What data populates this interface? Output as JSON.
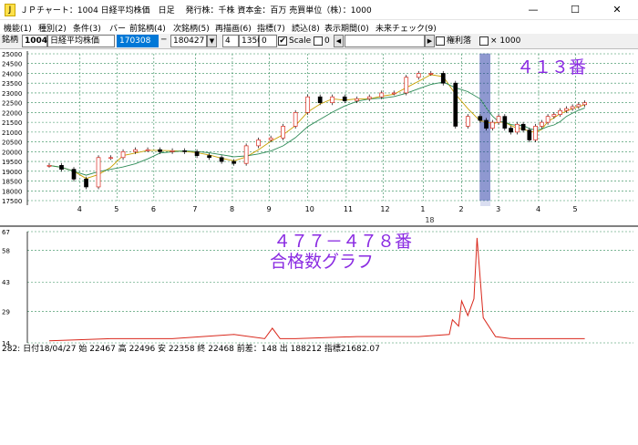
{
  "window": {
    "title": "ＪＰチャート：1004 日経平均株価　日足　 発行株：千株 資本金：百万 売買単位（株）：1000",
    "icon_glyph": "J",
    "min_glyph": "—",
    "max_glyph": "☐",
    "close_glyph": "✕"
  },
  "menu": [
    "機能(1)",
    "種別(2)",
    "条件(3)",
    "バー",
    "前銘柄(4)",
    "次銘柄(5)",
    "再描画(6)",
    "指標(7)",
    "読込(8)",
    "表示期間(0)",
    "未来チェック(9)"
  ],
  "toolbar": {
    "code_label": "銘柄",
    "code": "1004",
    "name": "日経平均株価",
    "from_date": "170308",
    "dash": "─",
    "to_date": "180427",
    "period": "4",
    "value1": "1350",
    "value2": "0",
    "scale_checked": "✔",
    "scale_label": "Scale",
    "zero_label": "0",
    "scroll_left": "◀",
    "kenri_label": "権利落",
    "times_label": "× 1000"
  },
  "price_chart": {
    "yticks": [
      17500,
      18000,
      18500,
      19000,
      19500,
      20000,
      20500,
      21000,
      21500,
      22000,
      22500,
      23000,
      23500,
      24000,
      24500,
      25000
    ],
    "month_labels": [
      "4",
      "5",
      "6",
      "7",
      "8",
      "9",
      "10",
      "11",
      "12",
      "1",
      "2",
      "3",
      "4",
      "5"
    ],
    "year_label": "18",
    "annotation": "４１３番"
  },
  "sub_chart": {
    "yticks": [
      "67",
      "58",
      "43",
      "29",
      "14"
    ],
    "annotation_line1": "４７７－４７８番",
    "annotation_line2": "合格数グラフ"
  },
  "status_bar": "282: 日付18/04/27 始 22467 高 22496 安 22358 終 22468 前差：148 出 188212 指標21682.07",
  "chart_data": [
    {
      "type": "line",
      "yticks": [
        17500,
        18000,
        18500,
        19000,
        19500,
        20000,
        20500,
        21000,
        21500,
        22000,
        22500,
        23000,
        23500,
        24000,
        24500,
        25000
      ],
      "ylim": [
        17500,
        25000
      ],
      "x_labels": [
        "4",
        "5",
        "6",
        "7",
        "8",
        "9",
        "10",
        "11",
        "12",
        "1",
        "2",
        "3",
        "4",
        "5"
      ],
      "year_label": "18",
      "series": [
        {
          "x": [
            0,
            8,
            16,
            24,
            32,
            40,
            48,
            56,
            64,
            72,
            80,
            88,
            96,
            104,
            112,
            120,
            128,
            136,
            144,
            152,
            160,
            168,
            176,
            184,
            192,
            200,
            208,
            216,
            224,
            232,
            240,
            248,
            256,
            264,
            272,
            280,
            284,
            288,
            292,
            296,
            300,
            304,
            308,
            312,
            316,
            320,
            324,
            328,
            332,
            336,
            340,
            344,
            348
          ],
          "values": [
            19300,
            19100,
            18600,
            18200,
            19700,
            19700,
            20000,
            20100,
            20100,
            20000,
            20050,
            20000,
            19800,
            19700,
            19500,
            19400,
            20300,
            20600,
            20700,
            21300,
            22000,
            22800,
            22500,
            22800,
            22600,
            22700,
            22800,
            23000,
            23000,
            23800,
            24000,
            24000,
            23500,
            21300,
            21800,
            21600,
            21200,
            21500,
            21800,
            21200,
            21000,
            21400,
            21100,
            20600,
            21300,
            21500,
            21800,
            21900,
            22100,
            22200,
            22300,
            22400,
            22500
          ]
        }
      ]
    },
    {
      "type": "line",
      "yticks": [
        "67",
        "58",
        "43",
        "29",
        "14"
      ],
      "ylim": [
        14,
        67
      ],
      "series": [
        {
          "x": [
            0,
            40,
            80,
            120,
            140,
            145,
            150,
            160,
            200,
            240,
            260,
            262,
            266,
            268,
            272,
            276,
            278,
            282,
            290,
            300,
            320,
            348
          ],
          "values": [
            15,
            16,
            16,
            18,
            16,
            21,
            16,
            16,
            17,
            17,
            18,
            25,
            22,
            34,
            27,
            35,
            64,
            26,
            17,
            16,
            16,
            16
          ]
        }
      ]
    }
  ]
}
